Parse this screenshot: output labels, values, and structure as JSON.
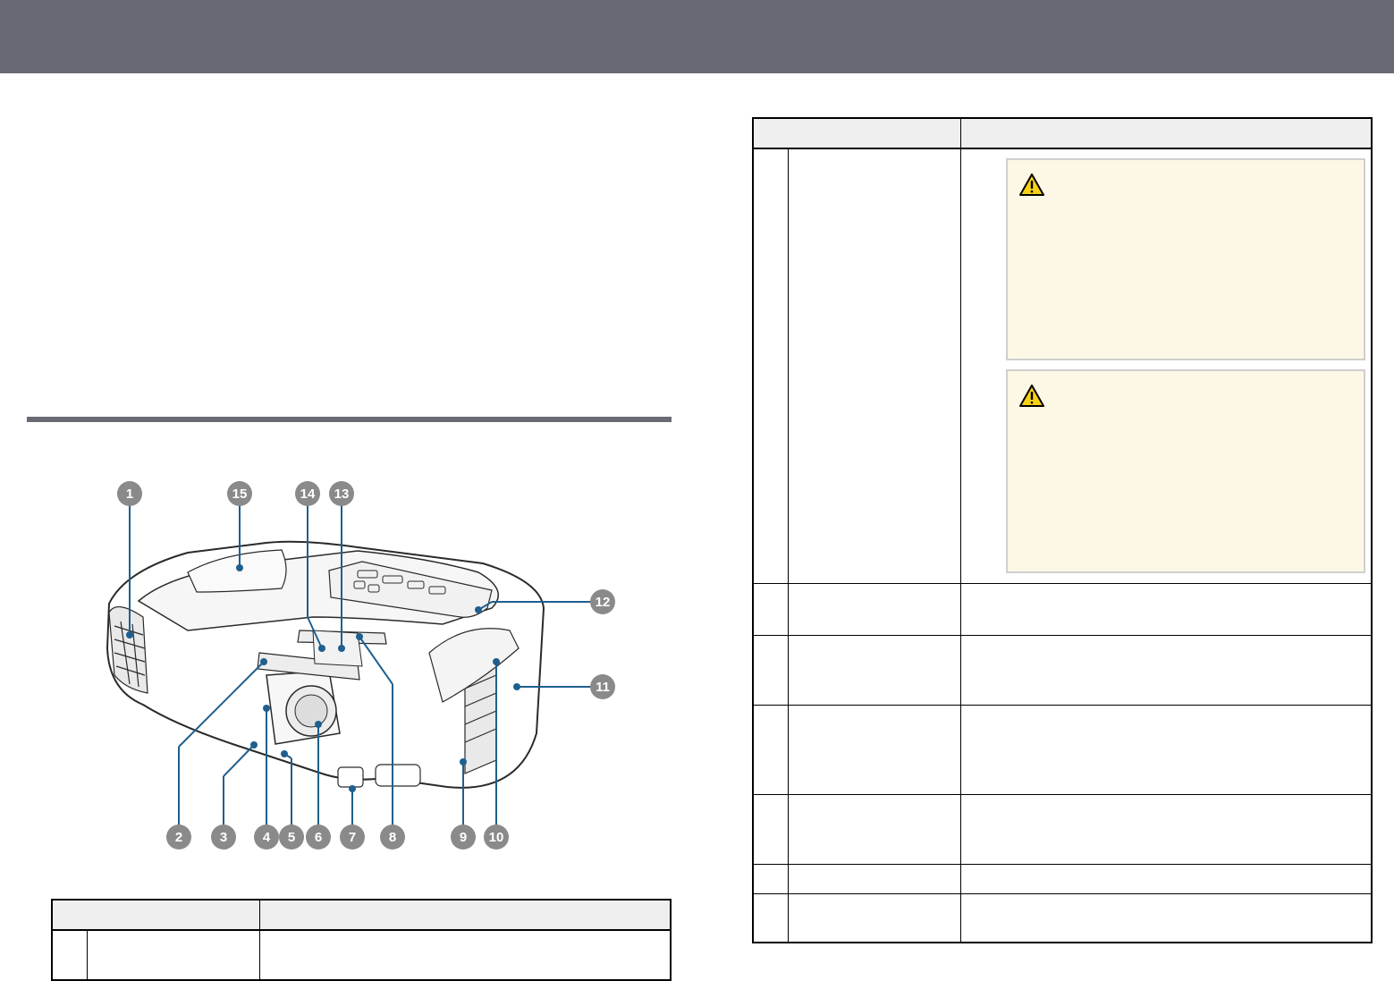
{
  "figure": {
    "callouts": [
      "1",
      "2",
      "3",
      "4",
      "5",
      "6",
      "7",
      "8",
      "9",
      "10",
      "11",
      "12",
      "13",
      "14",
      "15"
    ],
    "callout_color": "#1f5f8f"
  },
  "left_table": {
    "rows": 1
  },
  "right_table": {
    "rows": 7
  },
  "warning_icon": "warning-triangle-icon",
  "colors": {
    "header_bar": "#676a72",
    "callout_bg": "#fdf7e5",
    "table_header_bg": "#efefef"
  }
}
